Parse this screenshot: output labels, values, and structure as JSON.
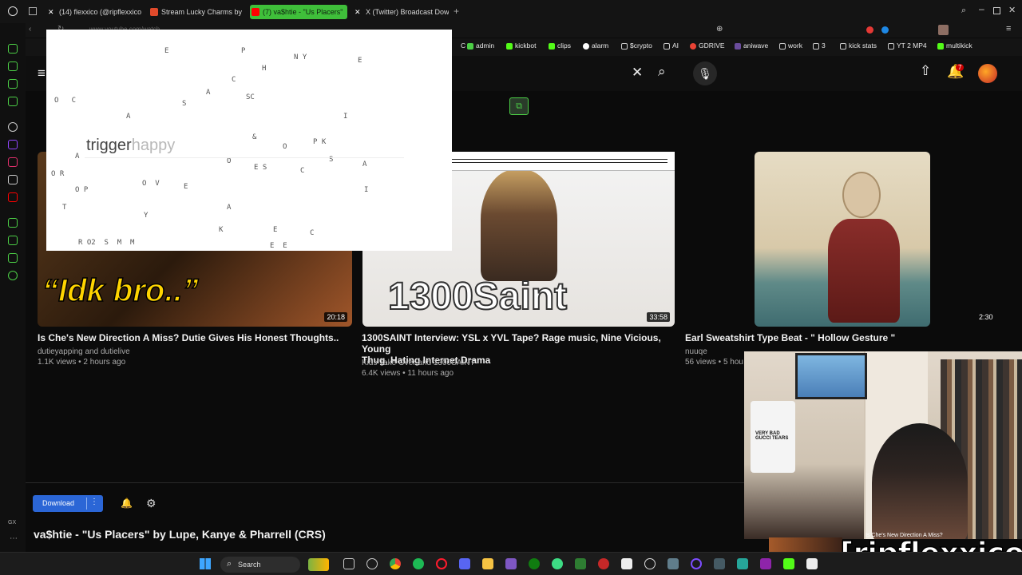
{
  "tabs": [
    {
      "label": "(14) flexxico (@ripflexxico",
      "color": "#ffffff"
    },
    {
      "label": "Stream Lucky Charms by",
      "color": "#e04a2b"
    },
    {
      "label": "(7) va$htie - \"Us Placers\"",
      "color": "#ff0000"
    },
    {
      "label": "X (Twitter) Broadcast Dow",
      "color": "#ffffff"
    }
  ],
  "address": {
    "url": "www.youtube.com/watch"
  },
  "bookmarks": [
    "C",
    "admin",
    "kickbot",
    "clips",
    "alarm",
    "$crypto",
    "AI",
    "GDRIVE",
    "aniwave",
    "work",
    "3",
    "kick stats",
    "YT 2 MP4",
    "multikick"
  ],
  "header": {
    "notif_count": "7"
  },
  "overlay": {
    "text_main": "trigger",
    "text_light": "happy"
  },
  "videos": [
    {
      "title": "Is Che's New Direction A Miss? Dutie Gives His Honest Thoughts..",
      "channel": "dutieyapping and dutielive",
      "meta": "1.1K views • 2 hours ago",
      "duration": "20:18",
      "thumb_text": "“Idk bro..”"
    },
    {
      "title_1": "1300SAINT Interview: YSL x YVL Tape? Rage music, Nine Vicious, Young",
      "title_2": "Thug, Hating Internet Drama",
      "channel": "Kids Take Over and 1300SAINT",
      "meta": "6.4K views • 11 hours ago",
      "duration": "33:58",
      "thumb_text": "1300Saint"
    },
    {
      "title": "Earl Sweatshirt Type Beat - \" Hollow Gesture \"",
      "channel": "nuuqe",
      "meta": "56 views • 5 hou",
      "duration": "2:30"
    }
  ],
  "player": {
    "download_label": "Download",
    "more_label": "⋮",
    "now_playing": "va$htie - \"Us Placers\" by Lupe, Kanye & Pharrell (CRS)"
  },
  "cam": {
    "shirt_text": "VERY BAD GUCCI TEARS",
    "overlay_caption": "Is Che's New Direction A Miss?"
  },
  "taskbar": {
    "search_label": "Search"
  },
  "watermark": "[ripflexxico]"
}
